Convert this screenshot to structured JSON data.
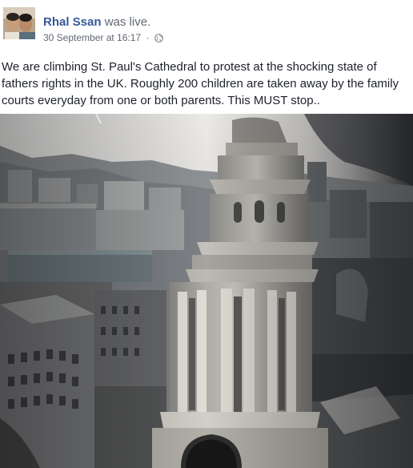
{
  "post": {
    "author": {
      "name": "Rhal Ssan",
      "action": "was live."
    },
    "meta": {
      "timestamp": "30 September at 16:17",
      "separator": "·",
      "privacy_icon": "globe-icon"
    },
    "text": "We are climbing St. Paul's Cathedral to protest at the shocking state of fathers rights in the UK. Roughly 200 children are taken away by the family courts everyday from one or both parents. This MUST stop..",
    "video": {
      "description_icon": "live-video-thumbnail"
    }
  },
  "colors": {
    "link": "#365899",
    "meta": "#616770",
    "text": "#1d2129"
  }
}
